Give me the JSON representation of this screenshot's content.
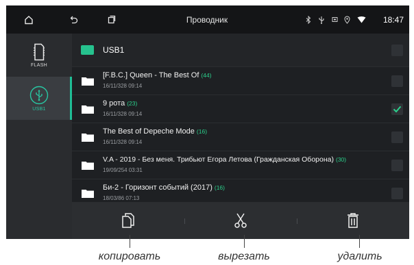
{
  "status_bar": {
    "home_icon": "home-icon",
    "back_icon": "back-icon",
    "recents_icon": "recents-icon",
    "title": "Проводник",
    "status_icons": [
      "bluetooth-icon",
      "usb-icon",
      "sd-card-icon",
      "location-icon",
      "wifi-icon"
    ],
    "time": "18:47"
  },
  "sidebar": {
    "items": [
      {
        "label": "FLASH",
        "icon": "flash-memory-icon",
        "active": false
      },
      {
        "label": "USB1",
        "icon": "usb-icon",
        "active": true
      }
    ]
  },
  "file_list": {
    "current_folder": "USB1",
    "rows": [
      {
        "name": "[F.B.C.] Queen - The Best Of",
        "count": "(44)",
        "date": "16/11/328 09:14",
        "checked": false
      },
      {
        "name": "9 рота",
        "count": "(23)",
        "date": "16/11/328 09:14",
        "checked": true
      },
      {
        "name": "The Best of Depeche Mode",
        "count": "(16)",
        "date": "16/11/328 09:14",
        "checked": false
      },
      {
        "name": "V.A - 2019 - Без меня. Трибьют Егора Летова (Гражданская Оборона)",
        "count": "(30)",
        "date": "19/09/254 03:31",
        "checked": false
      },
      {
        "name": "Би-2 - Горизонт событий (2017)",
        "count": "(16)",
        "date": "18/03/86 07:13",
        "checked": false
      }
    ]
  },
  "toolbar": {
    "buttons": [
      {
        "icon": "copy-icon"
      },
      {
        "icon": "cut-icon"
      },
      {
        "icon": "delete-icon"
      }
    ]
  },
  "callouts": {
    "copy": "копировать",
    "cut": "вырезать",
    "delete": "удалить"
  },
  "colors": {
    "accent": "#1fbe96",
    "count_green": "#2bd18c",
    "background": "#1e2023"
  }
}
